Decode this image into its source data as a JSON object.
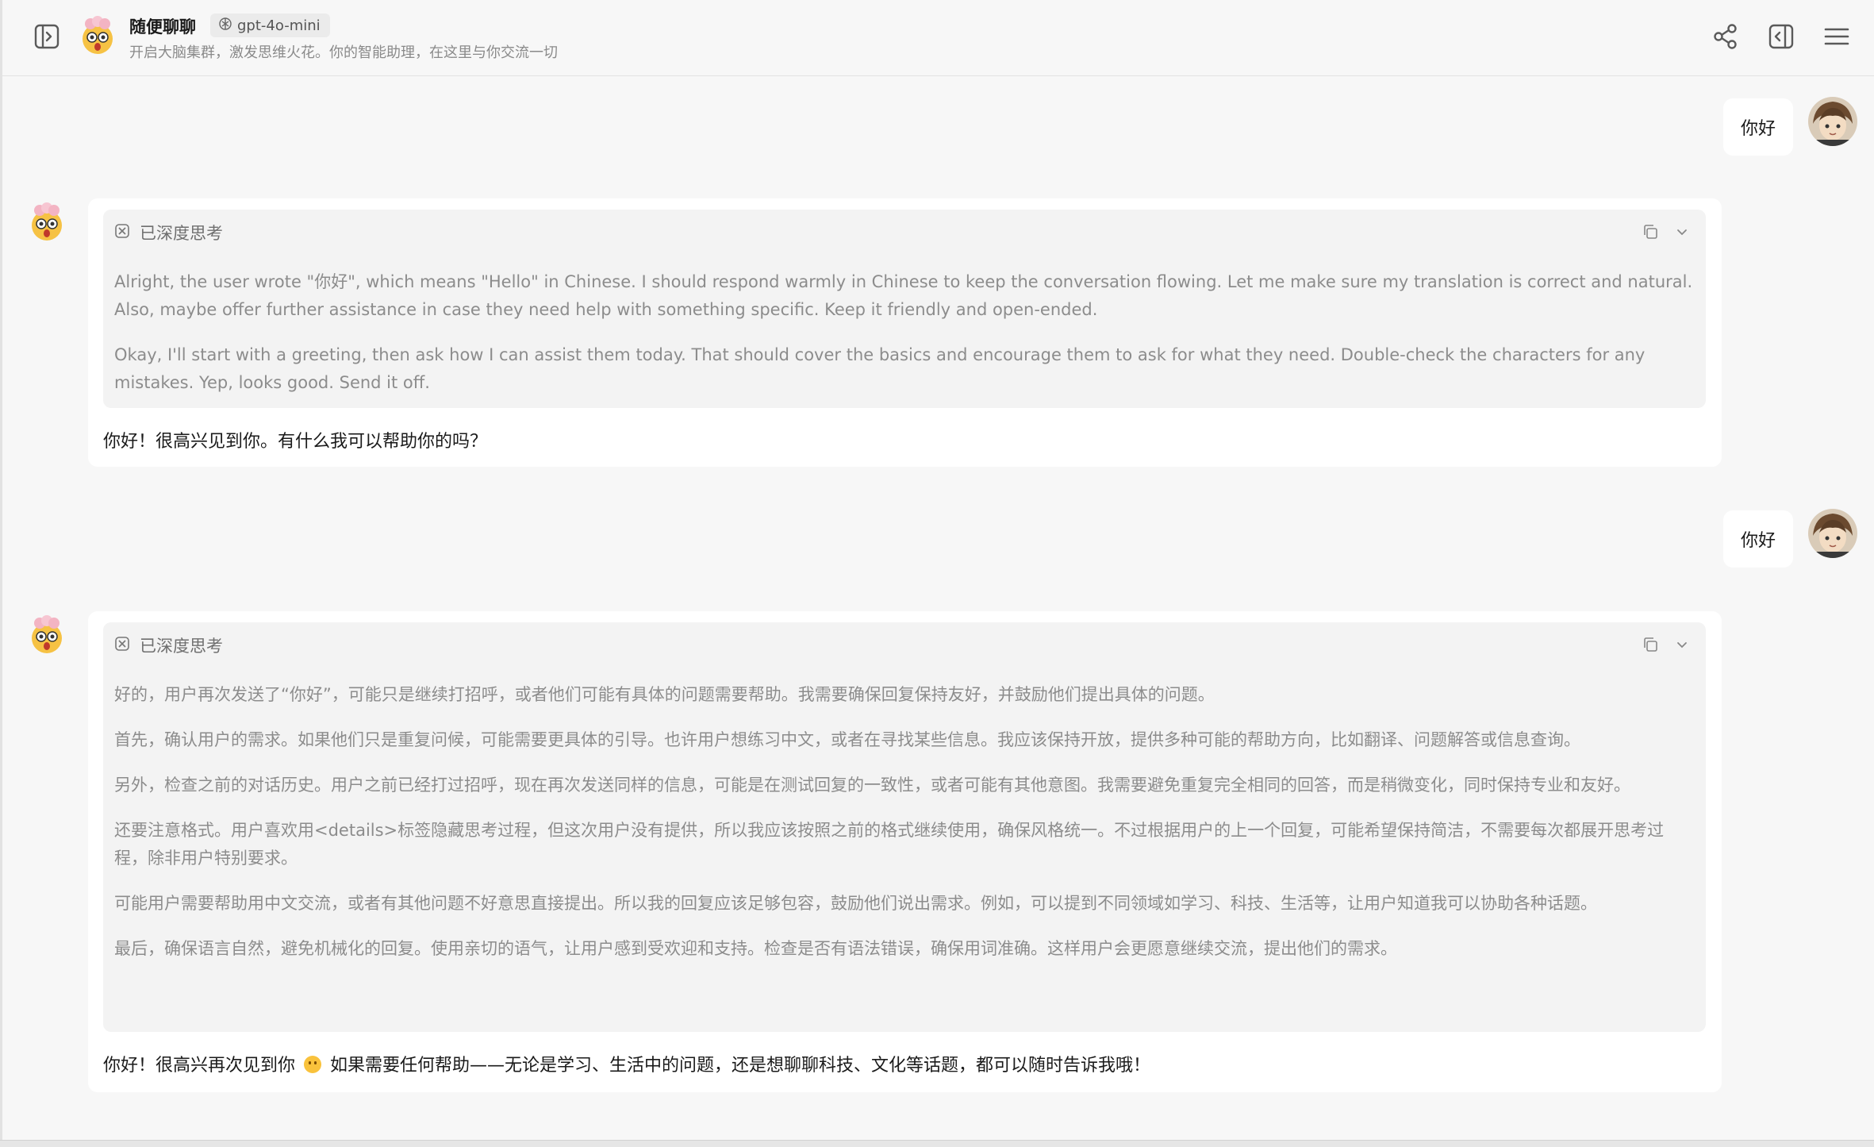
{
  "header": {
    "title": "随便聊聊",
    "model": "gpt-4o-mini",
    "subtitle": "开启大脑集群，激发思维火花。你的智能助理，在这里与你交流一切"
  },
  "conversation": [
    {
      "role": "user",
      "text": "你好"
    },
    {
      "role": "assistant",
      "thinking_label": "已深度思考",
      "thinking": [
        "Alright, the user wrote \"你好\", which means \"Hello\" in Chinese. I should respond warmly in Chinese to keep the conversation flowing. Let me make sure my translation is correct and natural. Also, maybe offer further assistance in case they need help with something specific. Keep it friendly and open-ended.",
        "Okay, I'll start with a greeting, then ask how I can assist them today. That should cover the basics and encourage them to ask for what they need. Double-check the characters for any mistakes. Yep, looks good. Send it off."
      ],
      "reply": "你好！很高兴见到你。有什么我可以帮助你的吗？"
    },
    {
      "role": "user",
      "text": "你好"
    },
    {
      "role": "assistant",
      "thinking_label": "已深度思考",
      "thinking": [
        "好的，用户再次发送了“你好”，可能只是继续打招呼，或者他们可能有具体的问题需要帮助。我需要确保回复保持友好，并鼓励他们提出具体的问题。",
        "首先，确认用户的需求。如果他们只是重复问候，可能需要更具体的引导。也许用户想练习中文，或者在寻找某些信息。我应该保持开放，提供多种可能的帮助方向，比如翻译、问题解答或信息查询。",
        "另外，检查之前的对话历史。用户之前已经打过招呼，现在再次发送同样的信息，可能是在测试回复的一致性，或者可能有其他意图。我需要避免重复完全相同的回答，而是稍微变化，同时保持专业和友好。",
        "还要注意格式。用户喜欢用<details>标签隐藏思考过程，但这次用户没有提供，所以我应该按照之前的格式继续使用，确保风格统一。不过根据用户的上一个回复，可能希望保持简洁，不需要每次都展开思考过程，除非用户特别要求。",
        "可能用户需要帮助用中文交流，或者有其他问题不好意思直接提出。所以我的回复应该足够包容，鼓励他们说出需求。例如，可以提到不同领域如学习、科技、生活等，让用户知道我可以协助各种话题。",
        "最后，确保语言自然，避免机械化的回复。使用亲切的语气，让用户感到受欢迎和支持。检查是否有语法错误，确保用词准确。这样用户会更愿意继续交流，提出他们的需求。"
      ],
      "reply_before_emoji": "你好！很高兴再次见到你",
      "reply_after_emoji": "如果需要任何帮助——无论是学习、生活中的问题，还是想聊聊科技、文化等话题，都可以随时告诉我哦！"
    }
  ],
  "icons": {
    "sidebar_toggle": "sidebar-toggle-icon",
    "model": "openai-logo-icon",
    "share": "share-icon",
    "panel": "right-panel-icon",
    "menu": "menu-icon",
    "thinking": "thinking-icon",
    "copy": "copy-icon",
    "collapse": "chevron-down-icon"
  },
  "colors": {
    "background": "#f7f7f7",
    "card": "#ffffff",
    "thinking_bg": "#f3f3f3",
    "thinking_text": "#8c8c8c",
    "text": "#1a1a1a"
  }
}
